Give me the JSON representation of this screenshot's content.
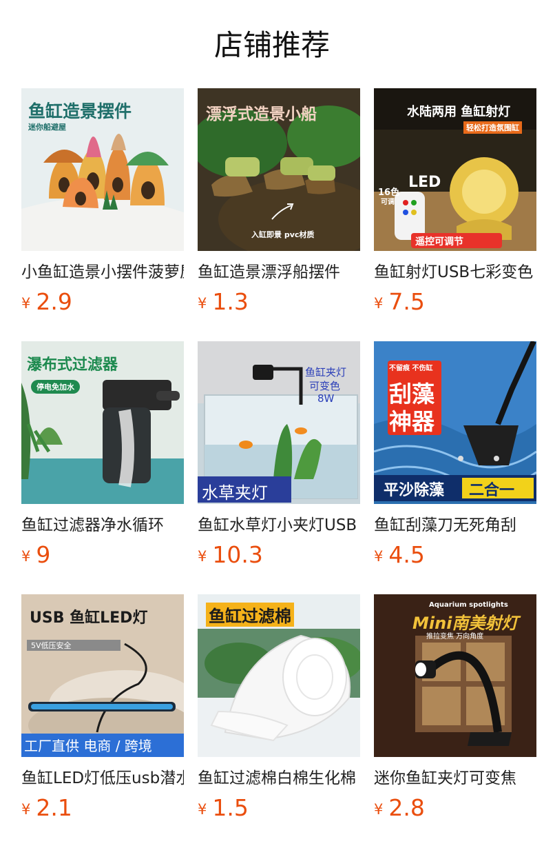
{
  "title": "店铺推荐",
  "products": [
    {
      "name": "小鱼缸造景小摆件菠萝屋",
      "currency": "¥",
      "price": "2.9",
      "image_texts": [
        "鱼缸造景摆件",
        "迷你船避屋"
      ],
      "image_bg": "#e6eeee"
    },
    {
      "name": "鱼缸造景漂浮船摆件",
      "currency": "¥",
      "price": "1.3",
      "image_texts": [
        "漂浮式造景小船",
        "入缸即景  pvc材质"
      ],
      "image_bg": "#5a4a2e"
    },
    {
      "name": "鱼缸射灯USB七彩变色",
      "currency": "¥",
      "price": "7.5",
      "image_texts": [
        "水陆两用 鱼缸射灯",
        "轻松打造氛围缸",
        "16色",
        "可调",
        "LED",
        "遥控可调节"
      ],
      "image_bg": "#2f2a1c"
    },
    {
      "name": "鱼缸过滤器净水循环",
      "currency": "¥",
      "price": "9",
      "image_texts": [
        "瀑布式过滤器",
        "停电免加水"
      ],
      "image_bg": "#dfe7e3"
    },
    {
      "name": "鱼缸水草灯小夹灯USB",
      "currency": "¥",
      "price": "10.3",
      "image_texts": [
        "鱼缸夹灯",
        "可变色",
        "8W",
        "水草夹灯"
      ],
      "image_bg": "#dcdcdc"
    },
    {
      "name": "鱼缸刮藻刀无死角刮",
      "currency": "¥",
      "price": "4.5",
      "image_texts": [
        "不留痕 不伤缸",
        "刮藻",
        "神器",
        "平沙除藻",
        "二合一"
      ],
      "image_bg": "#2a6fb8"
    },
    {
      "name": "鱼缸LED灯低压usb潜水",
      "currency": "¥",
      "price": "2.1",
      "image_texts": [
        "USB 鱼缸LED灯",
        "5V低压安全",
        "工厂直供  电商 / 跨境"
      ],
      "image_bg": "#d8c8b4"
    },
    {
      "name": "鱼缸过滤棉白棉生化棉",
      "currency": "¥",
      "price": "1.5",
      "image_texts": [
        "鱼缸过滤棉"
      ],
      "image_bg": "#e8eef0"
    },
    {
      "name": "迷你鱼缸夹灯可变焦",
      "currency": "¥",
      "price": "2.8",
      "image_texts": [
        "Aquarium spotlights",
        "Mini南美射灯",
        "推拉变焦  万向角度"
      ],
      "image_bg": "#4a2e1c"
    }
  ]
}
